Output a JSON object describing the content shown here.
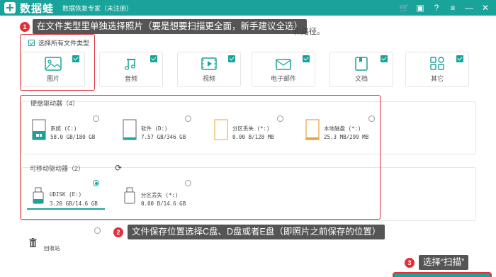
{
  "titlebar": {
    "app_name": "数据蛙",
    "subtitle": "数据恢复专家（未注册）",
    "icons": [
      "cart-icon",
      "gift-icon",
      "help-icon",
      "menu-icon",
      "minimize-icon",
      "close-icon"
    ],
    "icon_glyphs": [
      "🛒",
      "▣",
      "?",
      "≡",
      "—",
      "✕"
    ]
  },
  "callouts": {
    "c1_num": "1",
    "c1_text": "在文件类型里单独选择照片（要是想要扫描更全面，新手建议全选）",
    "c2_num": "2",
    "c2_text": "文件保存位置选择C盘、D盘或者E盘（即照片之前保存的位置）",
    "c3_num": "3",
    "c3_text": "选择“扫描”"
  },
  "path_tail": "和路径。",
  "select_all_label": "选择所有文件类型",
  "file_types": [
    {
      "label": "图片",
      "icon": "image-icon",
      "checked": true
    },
    {
      "label": "音频",
      "icon": "music-icon",
      "checked": true
    },
    {
      "label": "视频",
      "icon": "video-icon",
      "checked": true
    },
    {
      "label": "电子邮件",
      "icon": "mail-icon",
      "checked": true
    },
    {
      "label": "文档",
      "icon": "document-icon",
      "checked": true
    },
    {
      "label": "其它",
      "icon": "other-icon",
      "checked": true
    }
  ],
  "hard_drives": {
    "title": "硬盘驱动器（4）",
    "items": [
      {
        "name": "系统 (C:)",
        "size": "58.0 GB/180 GB",
        "selected": false
      },
      {
        "name": "软件 (D:)",
        "size": "7.57 GB/346 GB",
        "selected": false
      },
      {
        "name": "分区丢失 (*:)",
        "size": "0.00  B/128 MB",
        "selected": false
      },
      {
        "name": "本地磁盘 (*:)",
        "size": "25.3 MB/299 MB",
        "selected": false
      }
    ]
  },
  "removable_drives": {
    "title": "可移动驱动器（2）",
    "items": [
      {
        "name": "UDISK (E:)",
        "size": "3.20 GB/14.6 GB",
        "selected": true
      },
      {
        "name": "分区丢失 (*:)",
        "size": "0.00  B/14.6 GB",
        "selected": false
      }
    ]
  },
  "recycle_bin_label": "回收站",
  "colors": {
    "accent": "#19a39a",
    "annotation_red": "#e0313a",
    "callout_bg": "#555555"
  }
}
